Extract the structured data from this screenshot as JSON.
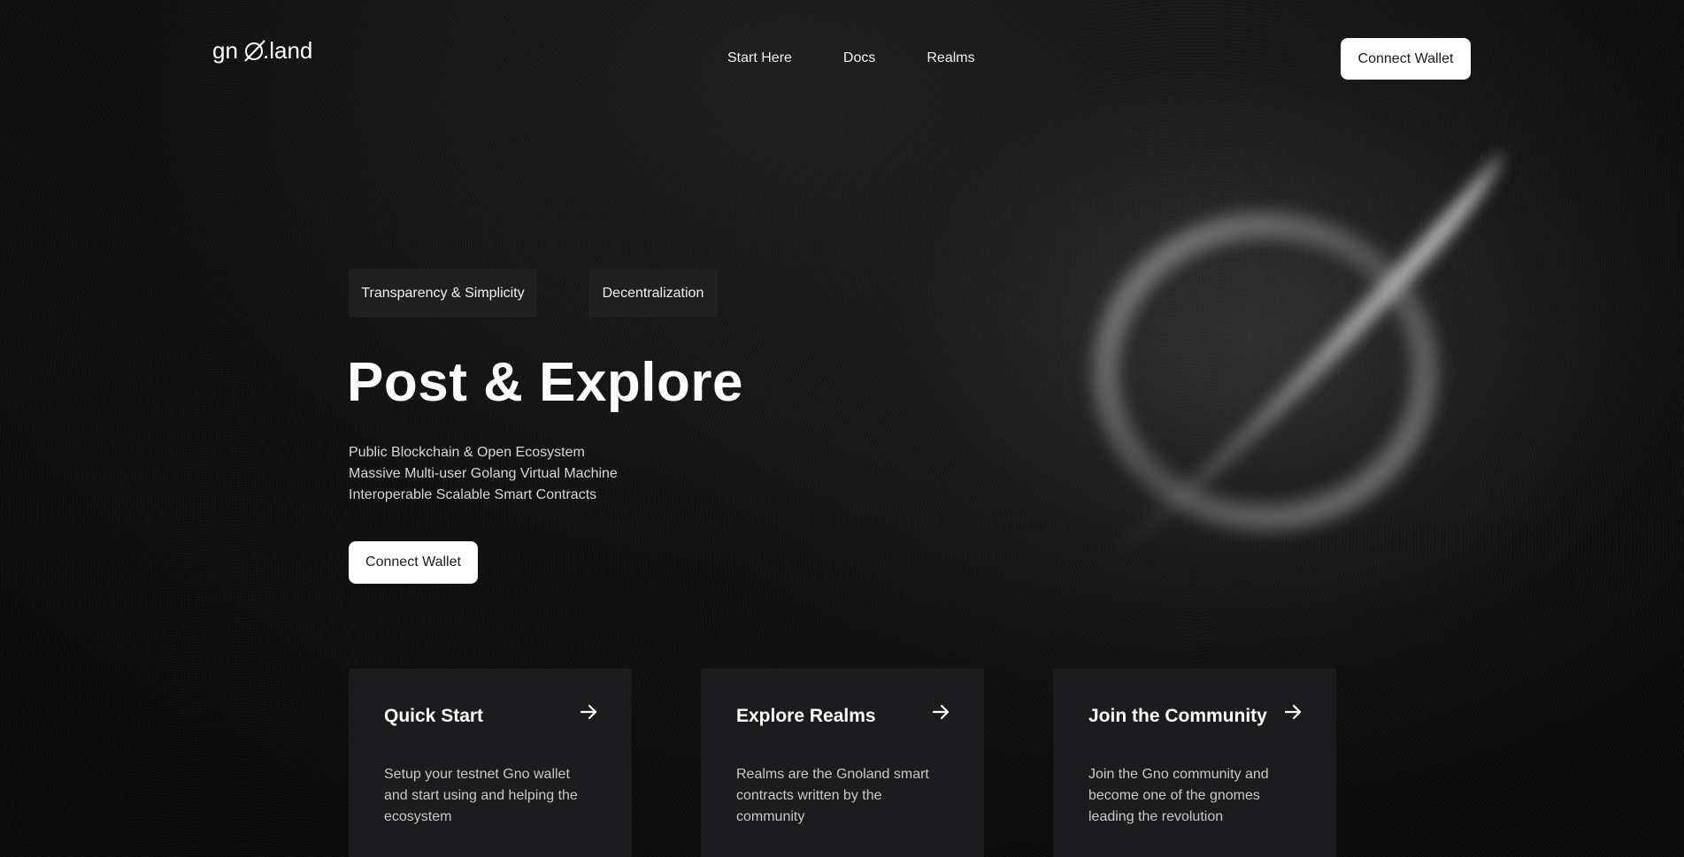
{
  "header": {
    "logo_text": "gnø.land",
    "nav": [
      {
        "label": "Start Here"
      },
      {
        "label": "Docs"
      },
      {
        "label": "Realms"
      }
    ],
    "connect_label": "Connect Wallet"
  },
  "hero": {
    "tags": [
      "Transparency & Simplicity",
      "Decentralization"
    ],
    "title": "Post & Explore",
    "lines": [
      "Public Blockchain & Open Ecosystem",
      "Massive Multi-user Golang Virtual Machine",
      "Interoperable Scalable Smart Contracts"
    ],
    "connect_label": "Connect Wallet"
  },
  "cards": [
    {
      "title": "Quick Start",
      "description": "Setup your testnet Gno wallet and start using and helping the ecosystem",
      "icon": "arrow-right-icon"
    },
    {
      "title": "Explore Realms",
      "description": "Realms are the Gnoland smart contracts written by the community",
      "icon": "arrow-right-icon"
    },
    {
      "title": "Join the Community",
      "description": "Join the Gno community and become one of the gnomes leading the revolution",
      "icon": "arrow-right-icon"
    }
  ],
  "colors": {
    "background": "#0b0b0b",
    "card": "#1c1c1e",
    "tag": "#202020",
    "button": "#ffffff",
    "button_text": "#1a1a1a"
  }
}
